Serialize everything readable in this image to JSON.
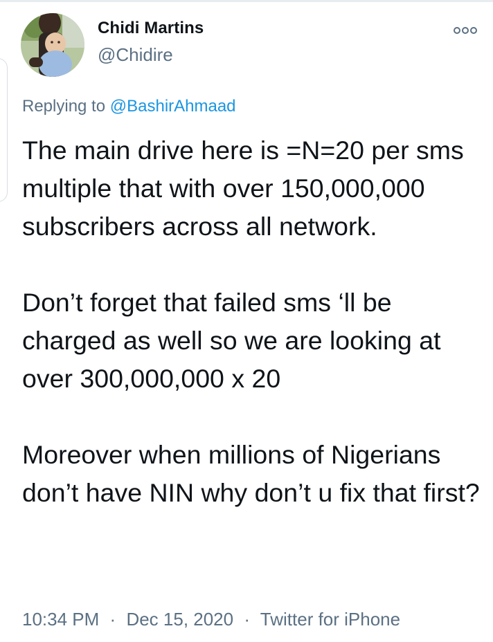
{
  "tweet": {
    "author": {
      "display_name": "Chidi Martins",
      "handle": "@Chidire"
    },
    "more_icon": "more-options-icon",
    "replying_prefix": "Replying to",
    "replying_to": "@BashirAhmaad",
    "paragraphs": [
      "The main drive here is =N=20 per sms multiple that with over 150,000,000 subscribers across all network.",
      "Don’t forget that failed sms ‘ll be charged as well so we are looking at over 300,000,000 x 20",
      "Moreover when millions of Nigerians don’t have NIN why don’t u fix that first?"
    ],
    "meta": {
      "time": "10:34 PM",
      "separator": "·",
      "date": "Dec 15, 2020",
      "source": "Twitter for iPhone"
    }
  },
  "colors": {
    "text": "#0f1419",
    "secondary": "#5b7083",
    "link": "#1b95e0"
  }
}
